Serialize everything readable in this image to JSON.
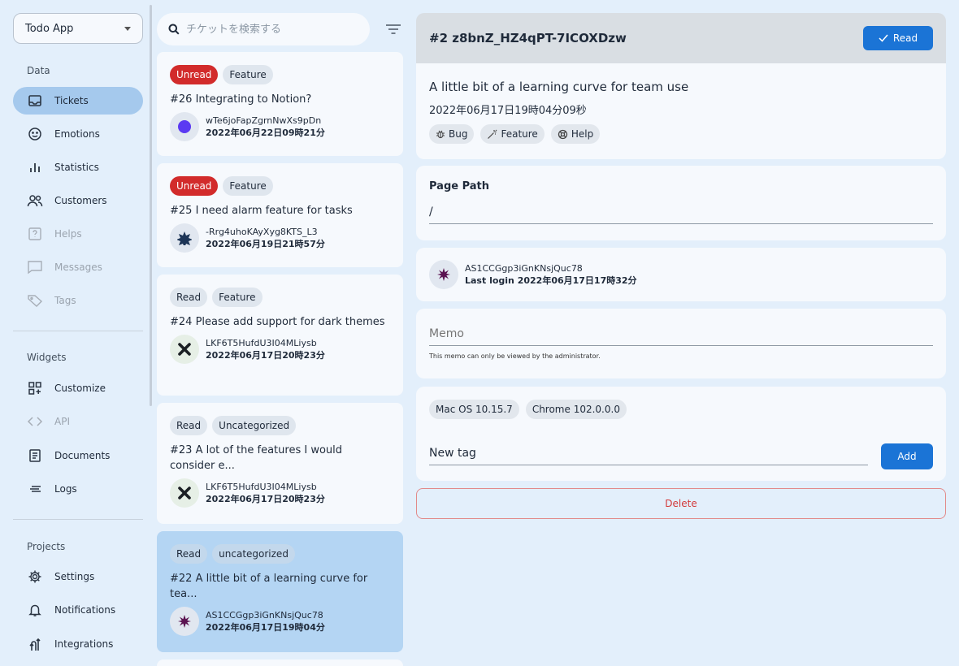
{
  "app_select": {
    "value": "Todo App"
  },
  "sidebar": {
    "sections": {
      "data": "Data",
      "widgets": "Widgets",
      "projects": "Projects"
    },
    "items": [
      {
        "label": "Tickets"
      },
      {
        "label": "Emotions"
      },
      {
        "label": "Statistics"
      },
      {
        "label": "Customers"
      },
      {
        "label": "Helps"
      },
      {
        "label": "Messages"
      },
      {
        "label": "Tags"
      },
      {
        "label": "Customize"
      },
      {
        "label": "API"
      },
      {
        "label": "Documents"
      },
      {
        "label": "Logs"
      },
      {
        "label": "Settings"
      },
      {
        "label": "Notifications"
      },
      {
        "label": "Integrations"
      }
    ]
  },
  "search": {
    "placeholder": "チケットを検索する"
  },
  "tickets": [
    {
      "status": "Unread",
      "category": "Feature",
      "title": "#26 Integrating to Notion?",
      "user": "wTe6joFapZgrnNwXs9pDn",
      "date": "2022年06月22日09時21分"
    },
    {
      "status": "Unread",
      "category": "Feature",
      "title": "#25 I need alarm feature for tasks",
      "user": "-Rrg4uhoKAyXyg8KTS_L3",
      "date": "2022年06月19日21時57分"
    },
    {
      "status": "Read",
      "category": "Feature",
      "title": "#24 Please add support for dark themes",
      "user": "LKF6T5HufdU3I04MLiysb",
      "date": "2022年06月17日20時23分"
    },
    {
      "status": "Read",
      "category": "Uncategorized",
      "title": "#23 A lot of the features I would consider e...",
      "user": "LKF6T5HufdU3I04MLiysb",
      "date": "2022年06月17日20時23分"
    },
    {
      "status": "Read",
      "category": "uncategorized",
      "title": "#22 A little bit of a learning curve for tea...",
      "user": "AS1CCGgp3iGnKNsjQuc78",
      "date": "2022年06月17日19時04分"
    }
  ],
  "detail": {
    "id": "#2 z8bnZ_HZ4qPT-7ICOXDzw",
    "read_label": "Read",
    "title": "A little bit of a learning curve for team use",
    "date": "2022年06月17日19時04分09秒",
    "tags": [
      "Bug",
      "Feature",
      "Help"
    ],
    "page_path_label": "Page Path",
    "page_path_value": "/",
    "user": "AS1CCGgp3iGnKNsjQuc78",
    "last_login": "Last login 2022年06月17日17時32分",
    "memo_placeholder": "Memo",
    "memo_hint": "This memo can only be viewed by the administrator.",
    "env_tags": [
      "Mac OS 10.15.7",
      "Chrome 102.0.0.0"
    ],
    "new_tag_value": "New tag",
    "add_label": "Add",
    "delete_label": "Delete"
  },
  "colors": {
    "accent": "#1b74d6",
    "unread": "#d22b2b",
    "selected_bg": "#b4d5f3",
    "background": "#e3effb"
  }
}
